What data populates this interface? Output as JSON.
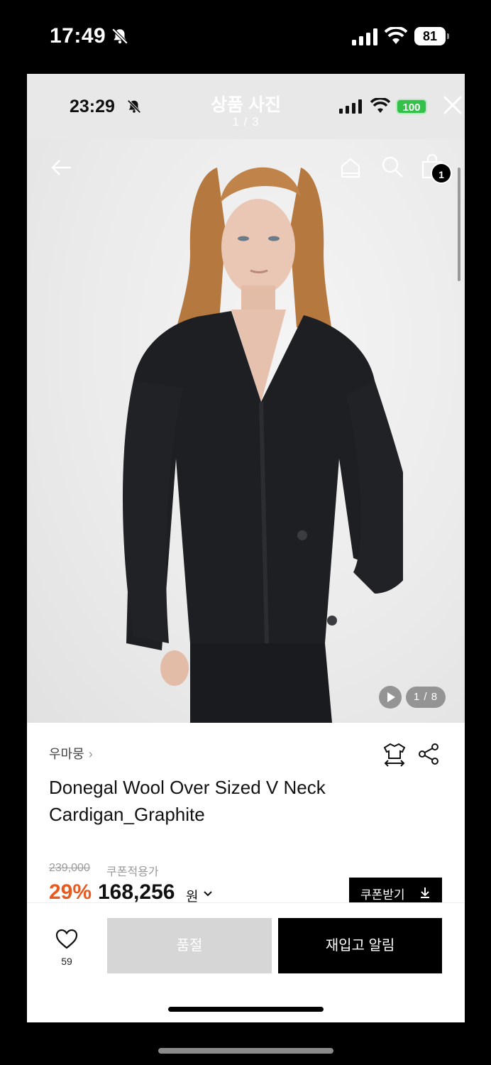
{
  "outer_status": {
    "time": "17:49",
    "battery": "81"
  },
  "inner_status": {
    "time": "23:29",
    "battery": "100"
  },
  "viewer": {
    "title": "상품 사진",
    "counter": "1 / 3"
  },
  "image": {
    "bag_count": "1",
    "image_counter": "1 / 8"
  },
  "product": {
    "brand": "우마뭉",
    "title_line1": "Donegal Wool Over Sized V Neck",
    "title_line2": "Cardigan_Graphite",
    "original_price": "239,000",
    "coupon_label": "쿠폰적용가",
    "discount": "29%",
    "sale_price": "168,256",
    "currency": "원",
    "coupon_button": "쿠폰받기"
  },
  "actions": {
    "wish_count": "59",
    "soldout_label": "품절",
    "restock_label": "재입고 알림"
  },
  "colors": {
    "discount": "#e85a20",
    "battery_inner": "#35c04a"
  }
}
